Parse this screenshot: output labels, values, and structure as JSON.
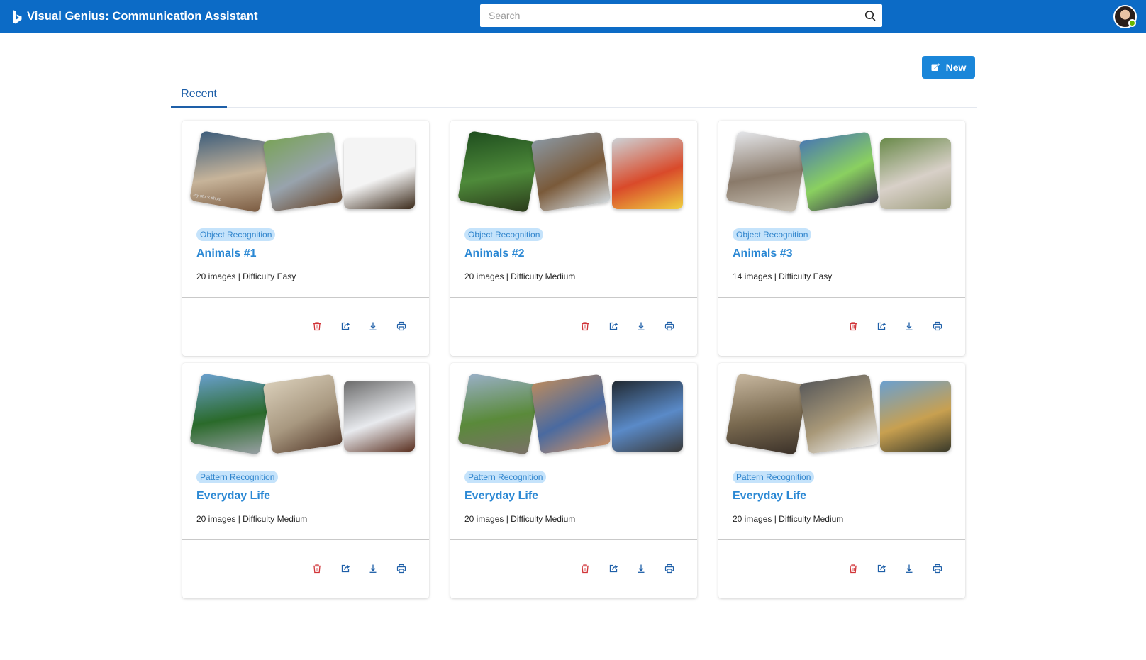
{
  "app": {
    "title": "Visual Genius: Communication Assistant"
  },
  "search": {
    "placeholder": "Search"
  },
  "toolbar": {
    "new_label": "New"
  },
  "tabs": [
    {
      "label": "Recent",
      "active": true
    }
  ],
  "colors": {
    "header": "#0c6bc6",
    "accent": "#2b88d4",
    "tag_bg": "#c5e3fb",
    "delete": "#d13438"
  },
  "cards": [
    {
      "tag": "Object Recognition",
      "title": "Animals #1",
      "meta": "20 images | Difficulty Easy",
      "photo_labels": [
        "my stock photo"
      ]
    },
    {
      "tag": "Object Recognition",
      "title": "Animals #2",
      "meta": "20 images | Difficulty Medium"
    },
    {
      "tag": "Object Recognition",
      "title": "Animals #3",
      "meta": "14 images | Difficulty Easy"
    },
    {
      "tag": "Pattern Recognition",
      "title": "Everyday Life",
      "meta": "20 images | Difficulty Medium"
    },
    {
      "tag": "Pattern Recognition",
      "title": "Everyday Life",
      "meta": "20 images | Difficulty Medium"
    },
    {
      "tag": "Pattern Recognition",
      "title": "Everyday Life",
      "meta": "20 images | Difficulty Medium"
    }
  ],
  "card_actions": [
    "delete-icon",
    "share-icon",
    "download-icon",
    "print-icon"
  ]
}
